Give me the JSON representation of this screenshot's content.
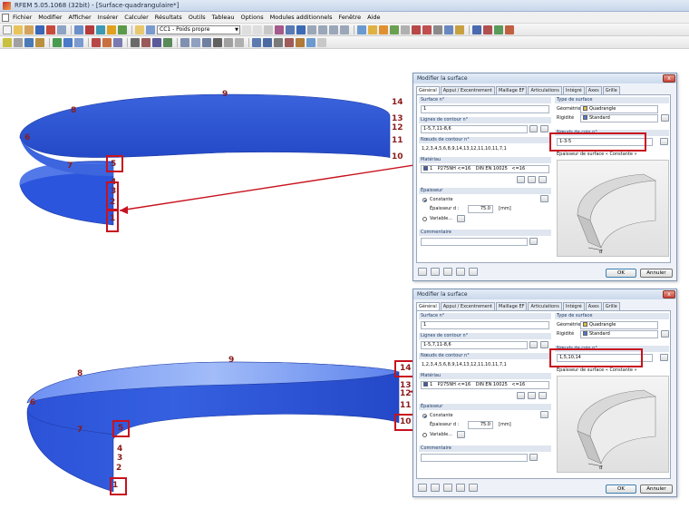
{
  "window": {
    "title": "RFEM 5.05.1068 (32bit) - [Surface-quadrangulaire*]"
  },
  "menu": [
    "Fichier",
    "Modifier",
    "Afficher",
    "Insérer",
    "Calculer",
    "Résultats",
    "Outils",
    "Tableau",
    "Options",
    "Modules additionnels",
    "Fenêtre",
    "Aide"
  ],
  "toolbar": {
    "load_case": "CC1 - Poids propre"
  },
  "model_top": {
    "nodes": [
      "1",
      "2",
      "3",
      "4",
      "5",
      "6",
      "7",
      "8",
      "9",
      "10",
      "11",
      "12",
      "13",
      "14"
    ]
  },
  "model_bottom": {
    "nodes": [
      "1",
      "2",
      "3",
      "4",
      "5",
      "6",
      "7",
      "8",
      "9",
      "10",
      "11",
      "12",
      "13",
      "14"
    ]
  },
  "dialog": {
    "title": "Modifier la surface",
    "close": "x",
    "tabs": [
      "Général",
      "Appui / Excentrement",
      "Maillage EF",
      "Articulations",
      "Intégré",
      "Axes",
      "Grille"
    ],
    "surface_no_label": "Surface n°",
    "surface_no": "1",
    "contour_lines_label": "Lignes de contour n°",
    "contour_lines": "1-5,7,11-8,6",
    "contour_nodes_label": "Nœuds de contour n°",
    "contour_nodes": "1,2,3,4,5,6,8,9,14,13,12,11,10,11,7,1",
    "material_label": "Matériau",
    "material_no": "1",
    "material_name": "P275NH <=16",
    "material_norm": "DIN EN 10025",
    "material_extra": "<=16",
    "thickness_label": "Épaisseur",
    "constant_label": "Constante",
    "thickness_d_label": "Épaisseur d :",
    "thickness_value": "75.0",
    "thickness_unit": "[mm]",
    "variable_label": "Variable...",
    "comment_label": "Commentaire",
    "surface_type_label": "Type de surface",
    "geometry_label": "Géométrie",
    "geometry_value": "Quadrangle",
    "stiffness_label": "Rigidité",
    "stiffness_value": "Standard",
    "corner_nodes_label": "Nœuds de coin n°",
    "corner_nodes_top": "1-3-5",
    "corner_nodes_bottom": "1,5,10,14",
    "preview_caption": "Épaisseur de surface « Constante »",
    "preview_d": "d",
    "ok": "OK",
    "cancel": "Annuler"
  },
  "colors": {
    "surface": "#2f5fe0",
    "surface_light": "#6f95f5",
    "highlight": "#c8121e",
    "node_text": "#8b1a1a"
  }
}
